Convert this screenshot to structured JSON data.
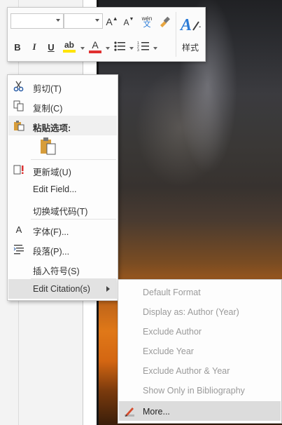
{
  "mini_toolbar": {
    "grow_font": "A",
    "shrink_font": "A",
    "phonetic_guide": "wén",
    "bold": "B",
    "italic": "I",
    "underline": "U",
    "highlight": "ab",
    "font_color": "A",
    "styles_label": "样式",
    "colors": {
      "highlight": "#ffe400",
      "font_color": "#e03030",
      "styles_icon": "#2b7bd6"
    }
  },
  "context_menu": {
    "items": [
      {
        "label": "剪切(T)",
        "icon": "scissors-icon"
      },
      {
        "label": "复制(C)",
        "icon": "copy-icon"
      },
      {
        "label": "粘贴选项:",
        "icon": "paste-icon"
      },
      {
        "label": "更新域(U)",
        "icon": "update-field-icon"
      },
      {
        "label": "Edit Field...",
        "icon": ""
      },
      {
        "label": "切换域代码(T)",
        "icon": ""
      },
      {
        "label": "字体(F)...",
        "icon": "font-icon"
      },
      {
        "label": "段落(P)...",
        "icon": "paragraph-icon"
      },
      {
        "label": "插入符号(S)",
        "icon": ""
      },
      {
        "label": "Edit Citation(s)",
        "icon": ""
      }
    ]
  },
  "submenu": {
    "items": [
      {
        "label": "Default Format",
        "enabled": false
      },
      {
        "label": "Display as: Author (Year)",
        "enabled": false
      },
      {
        "label": "Exclude Author",
        "enabled": false
      },
      {
        "label": "Exclude Year",
        "enabled": false
      },
      {
        "label": "Exclude Author & Year",
        "enabled": false
      },
      {
        "label": "Show Only in Bibliography",
        "enabled": false
      },
      {
        "label": "More...",
        "enabled": true,
        "icon": "pencil-icon"
      }
    ]
  }
}
